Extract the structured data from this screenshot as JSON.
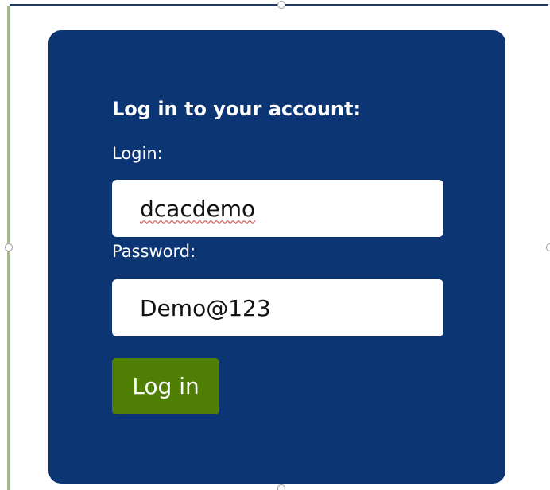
{
  "login_form": {
    "heading": "Log in to your account:",
    "login_label": "Login:",
    "login_value": "dcacdemo",
    "password_label": "Password:",
    "password_value": "Demo@123",
    "submit_label": "Log in"
  },
  "colors": {
    "card_background": "#0c3573",
    "button_background": "#4f7f04",
    "text": "#ffffff",
    "field_background": "#ffffff"
  }
}
